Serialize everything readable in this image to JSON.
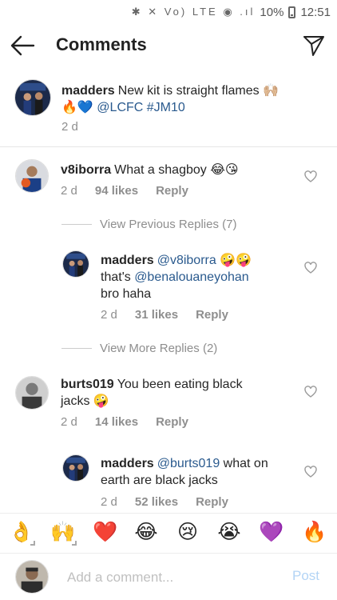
{
  "status_bar": {
    "icons": "✱ ✕ Vo) LTE ◉ .ıl",
    "battery": "10%",
    "time": "12:51"
  },
  "header": {
    "title": "Comments"
  },
  "caption": {
    "user": "madders",
    "text": "New kit is straight flames 🙌🏼",
    "line2_emoji": "🔥💙",
    "mention": "@LCFC",
    "hashtag": "#JM10",
    "time": "2 d"
  },
  "comments": [
    {
      "user": "v8iborra",
      "text": "What a shagboy 😂😘",
      "time": "2 d",
      "likes": "94 likes",
      "reply": "Reply",
      "view_previous": "View Previous Replies (7)",
      "replies": [
        {
          "user": "madders",
          "mention": "@v8iborra",
          "emoji": "🤪🤪",
          "line2_pre": "that's ",
          "line2_mention": "@benalouaneyohan",
          "line3": "bro haha",
          "time": "2 d",
          "likes": "31 likes",
          "reply": "Reply"
        }
      ],
      "view_more": "View More Replies (2)"
    },
    {
      "user": "burts019",
      "text": "You been eating black",
      "text2": "jacks 🤪",
      "time": "2 d",
      "likes": "14 likes",
      "reply": "Reply",
      "replies": [
        {
          "user": "madders",
          "mention": "@burts019",
          "text": "what on",
          "line2": "earth are black jacks",
          "time": "2 d",
          "likes": "52 likes",
          "reply": "Reply"
        }
      ]
    }
  ],
  "emoji_bar": [
    "👌",
    "🙌",
    "❤️",
    "😂",
    "😢",
    "😭",
    "💜",
    "🔥"
  ],
  "composer": {
    "placeholder": "Add a comment...",
    "post_label": "Post"
  }
}
